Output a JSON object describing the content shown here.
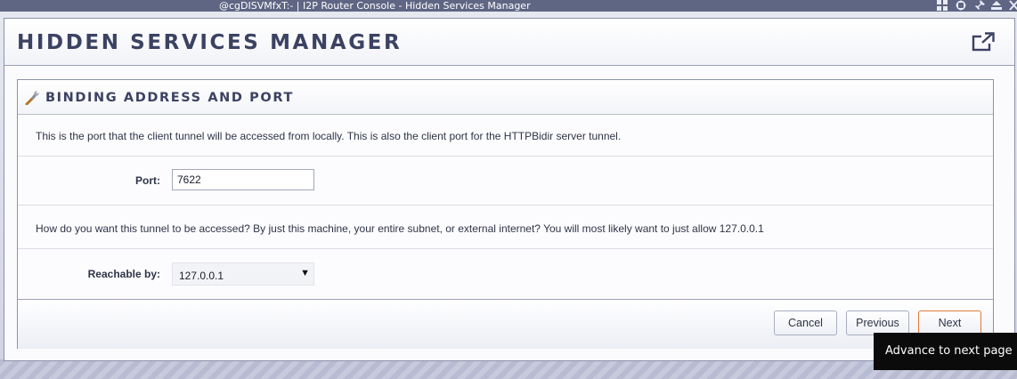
{
  "window": {
    "title": "@cgDISVMfxT:- | I2P Router Console - Hidden Services Manager"
  },
  "page": {
    "title": "HIDDEN SERVICES MANAGER"
  },
  "section": {
    "title": "BINDING ADDRESS AND PORT",
    "port_description": "This is the port that the client tunnel will be accessed from locally. This is also the client port for the HTTPBidir server tunnel.",
    "port_label": "Port:",
    "port_value": "7622",
    "reach_description": "How do you want this tunnel to be accessed? By just this machine, your entire subnet, or external internet? You will most likely want to just allow 127.0.0.1",
    "reach_label": "Reachable by:",
    "reach_selected": "127.0.0.1"
  },
  "buttons": {
    "cancel": "Cancel",
    "previous": "Previous",
    "next": "Next"
  },
  "tooltip": {
    "text": "Advance to next page"
  },
  "icons": {
    "window_controls": [
      "tile-icon",
      "move-icon",
      "pin-icon",
      "shade-icon",
      "close-icon"
    ],
    "popout": "popout-icon",
    "section": "wrench-icon"
  },
  "colors": {
    "titlebar": "#5f6684",
    "heading": "#3c4262",
    "next_border": "#e07a3a",
    "tooltip_bg": "#0b0b0b"
  }
}
